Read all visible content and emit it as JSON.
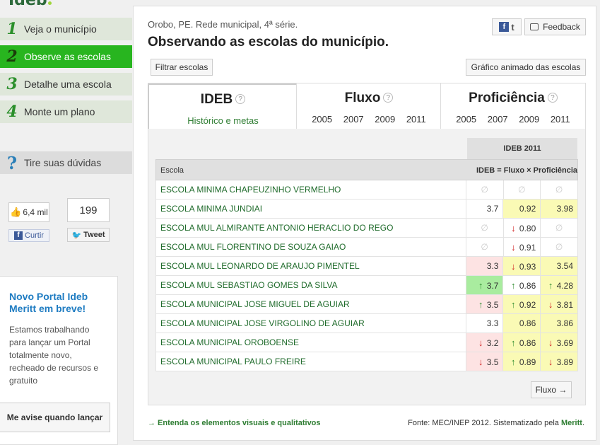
{
  "logo": {
    "text": "Ideb"
  },
  "nav": [
    {
      "num": "1",
      "label": "Veja o município",
      "active": false
    },
    {
      "num": "2",
      "label": "Observe as escolas",
      "active": true
    },
    {
      "num": "3",
      "label": "Detalhe uma escola",
      "active": false
    },
    {
      "num": "4",
      "label": "Monte um plano",
      "active": false
    }
  ],
  "help": {
    "icon": "question-icon",
    "label": "Tire suas dúvidas"
  },
  "social": {
    "fb_count": "6,4 mil",
    "fb_label": "Curtir",
    "tw_count": "199",
    "tw_label": "Tweet"
  },
  "promo": {
    "title": "Novo Portal Ideb Meritt em breve!",
    "body": "Estamos trabalhando para lançar um Portal totalmente novo, recheado de recursos e gratuito",
    "button": "Me avise quando lançar"
  },
  "header": {
    "breadcrumb": "Orobo, PE. Rede municipal, 4ª série.",
    "title": "Observando as escolas do município.",
    "feedback": "Feedback"
  },
  "buttons": {
    "filter": "Filtrar escolas",
    "animated": "Gráfico animado das escolas",
    "fluxo_next": "Fluxo →"
  },
  "tabs": {
    "ideb": {
      "title": "IDEB",
      "sub": "Histórico e metas"
    },
    "fluxo": {
      "title": "Fluxo",
      "years": [
        "2005",
        "2007",
        "2009",
        "2011"
      ]
    },
    "prof": {
      "title": "Proficiência",
      "years": [
        "2005",
        "2007",
        "2009",
        "2011"
      ]
    }
  },
  "table": {
    "group_header": "IDEB 2011",
    "col_escola": "Escola",
    "col_formula": "IDEB = Fluxo × Proficiência",
    "rows": [
      {
        "name": "ESCOLA MINIMA CHAPEUZINHO VERMELHO",
        "ideb": "∅",
        "fluxo": "∅",
        "prof": "∅"
      },
      {
        "name": "ESCOLA MINIMA JUNDIAI",
        "ideb": "3.7",
        "fluxo": "0.92",
        "prof": "3.98"
      },
      {
        "name": "ESCOLA MUL ALMIRANTE ANTONIO HERACLIO DO REGO",
        "ideb": "∅",
        "fluxo": "↓ 0.80",
        "prof": "∅"
      },
      {
        "name": "ESCOLA MUL FLORENTINO DE SOUZA GAIAO",
        "ideb": "∅",
        "fluxo": "↓ 0.91",
        "prof": "∅"
      },
      {
        "name": "ESCOLA MUL LEONARDO DE ARAUJO PIMENTEL",
        "ideb": "3.3",
        "fluxo": "↓ 0.93",
        "prof": "3.54"
      },
      {
        "name": "ESCOLA MUL SEBASTIAO GOMES DA SILVA",
        "ideb": "↑ 3.7",
        "fluxo": "↑ 0.86",
        "prof": "↑ 4.28"
      },
      {
        "name": "ESCOLA MUNICIPAL JOSE MIGUEL DE AGUIAR",
        "ideb": "↑ 3.5",
        "fluxo": "↑ 0.92",
        "prof": "↓ 3.81"
      },
      {
        "name": "ESCOLA MUNICIPAL JOSE VIRGOLINO DE AGUIAR",
        "ideb": "3.3",
        "fluxo": "0.86",
        "prof": "3.86"
      },
      {
        "name": "ESCOLA MUNICIPAL OROBOENSE",
        "ideb": "↓ 3.2",
        "fluxo": "↑ 0.86",
        "prof": "↓ 3.69"
      },
      {
        "name": "ESCOLA MUNICIPAL PAULO FREIRE",
        "ideb": "↓ 3.5",
        "fluxo": "↑ 0.89",
        "prof": "↓ 3.89"
      }
    ]
  },
  "footer": {
    "left": "→ Entenda os elementos visuais e qualitativos",
    "right_prefix": "Fonte: MEC/INEP 2012. Sistematizado pela ",
    "right_brand": "Meritt",
    "right_suffix": "."
  },
  "colors": {
    "accent_green": "#28b51f",
    "link_green": "#1f6b2b",
    "highlight_yellow": "#fafab5",
    "highlight_green": "#a9ec9f",
    "highlight_pink": "#fde3e3",
    "promo_blue": "#1f7cc2"
  }
}
